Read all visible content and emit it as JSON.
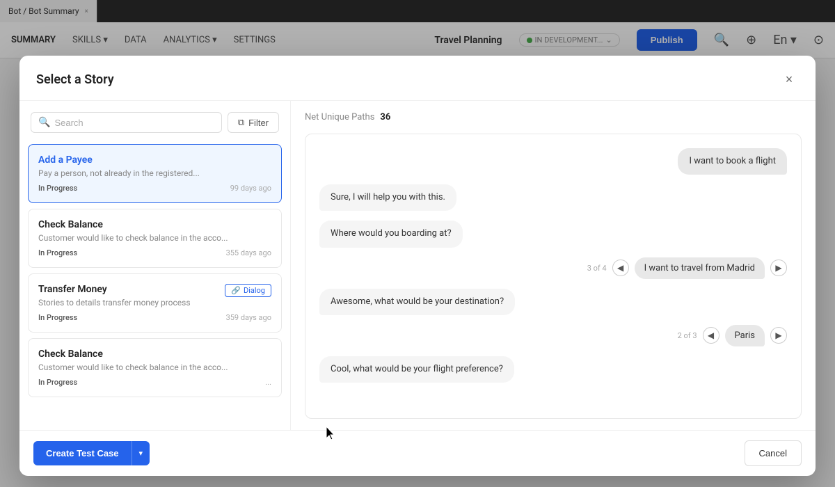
{
  "tab": {
    "label": "Bot / Bot Summary",
    "close_icon": "×"
  },
  "topnav": {
    "items": [
      {
        "label": "SUMMARY",
        "active": true
      },
      {
        "label": "SKILLS",
        "has_dropdown": true
      },
      {
        "label": "DATA"
      },
      {
        "label": "ANALYTICS",
        "has_dropdown": true
      },
      {
        "label": "SETTINGS"
      }
    ],
    "bot_name": "Travel Planning",
    "status_label": "IN DEVELOPMENT...",
    "publish_label": "Publish",
    "lang": "En"
  },
  "modal": {
    "title": "Select a Story",
    "close_icon": "×"
  },
  "search": {
    "placeholder": "Search"
  },
  "filter": {
    "label": "Filter"
  },
  "stories": [
    {
      "title": "Add a Payee",
      "description": "Pay a person, not already in the registered...",
      "status": "In Progress",
      "days_ago": "99 days ago",
      "selected": true,
      "dialog_badge": null
    },
    {
      "title": "Check Balance",
      "description": "Customer would like to check balance in the acco...",
      "status": "In Progress",
      "days_ago": "355 days ago",
      "selected": false,
      "dialog_badge": null
    },
    {
      "title": "Transfer Money",
      "description": "Stories to details transfer money process",
      "status": "In Progress",
      "days_ago": "359 days ago",
      "selected": false,
      "dialog_badge": "Dialog"
    },
    {
      "title": "Check Balance",
      "description": "Customer would like to check balance in the acco...",
      "status": "In Progress",
      "days_ago": "...",
      "selected": false,
      "dialog_badge": null
    }
  ],
  "paths": {
    "label": "Net Unique Paths",
    "count": "36"
  },
  "chat": {
    "messages": [
      {
        "type": "user",
        "text": "I want to book a flight"
      },
      {
        "type": "bot",
        "text": "Sure, I will help you with this."
      },
      {
        "type": "bot",
        "text": "Where would you boarding at?"
      },
      {
        "type": "user_nav",
        "counter": "3 of 4",
        "text": "I want to travel from Madrid"
      },
      {
        "type": "bot",
        "text": "Awesome, what would be your destination?"
      },
      {
        "type": "user_nav",
        "counter": "2 of 3",
        "text": "Paris"
      },
      {
        "type": "bot",
        "text": "Cool, what would be your flight preference?"
      }
    ]
  },
  "footer": {
    "create_label": "Create Test Case",
    "dropdown_icon": "|",
    "cancel_label": "Cancel"
  }
}
